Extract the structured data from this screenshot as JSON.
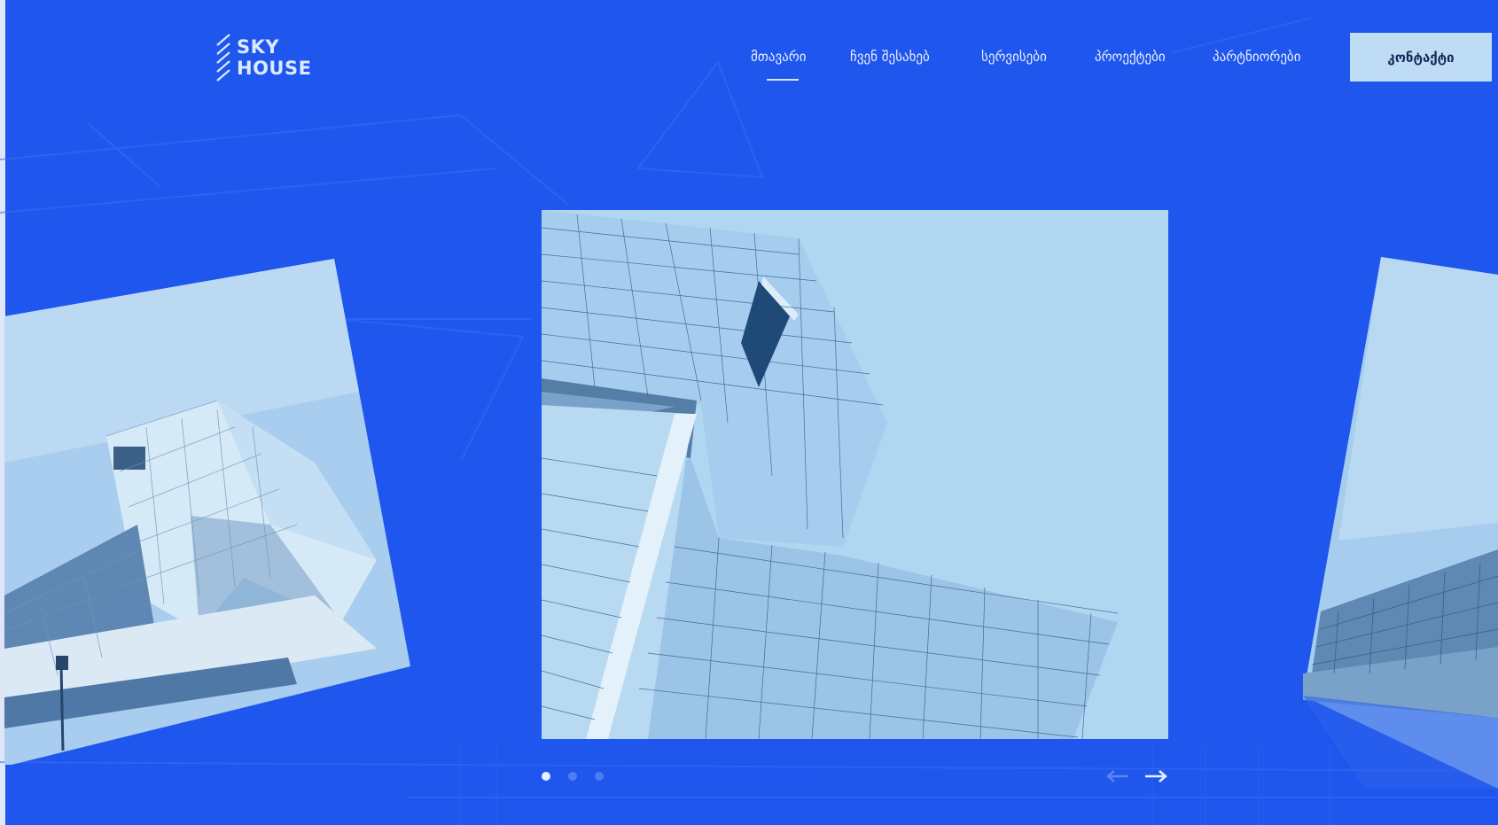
{
  "brand": {
    "line1": "SKY",
    "line2": "HOUSE"
  },
  "nav": [
    {
      "label": "მთავარი",
      "active": true
    },
    {
      "label": "ჩვენ შესახებ",
      "active": false
    },
    {
      "label": "სერვისები",
      "active": false
    },
    {
      "label": "პროექტები",
      "active": false
    },
    {
      "label": "პარტნიორები",
      "active": false
    }
  ],
  "contact_label": "კონტაქტი",
  "slider": {
    "slide_count": 3,
    "active_index": 0
  },
  "colors": {
    "background": "#1f56ee",
    "accent_light": "#bfdcf5",
    "image_tint": "#b0d6f1"
  },
  "icons": {
    "prev": "arrow-left-icon",
    "next": "arrow-right-icon",
    "logo": "stripes-logo-icon"
  }
}
